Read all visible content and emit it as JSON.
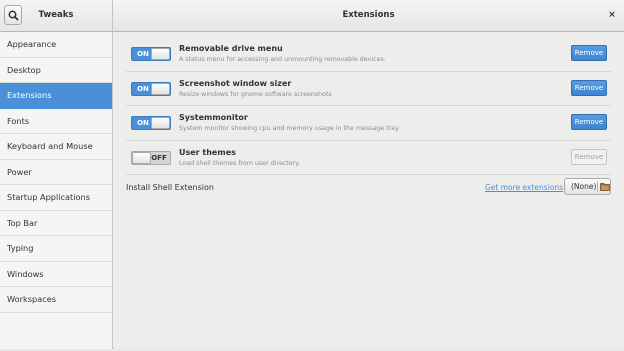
{
  "header": {
    "app_title": "Tweaks",
    "page_title": "Extensions",
    "close_glyph": "×",
    "icons": {
      "search": "search-icon",
      "close": "close-icon"
    }
  },
  "sidebar": {
    "items": [
      {
        "label": "Appearance",
        "active": false
      },
      {
        "label": "Desktop",
        "active": false
      },
      {
        "label": "Extensions",
        "active": true
      },
      {
        "label": "Fonts",
        "active": false
      },
      {
        "label": "Keyboard and Mouse",
        "active": false
      },
      {
        "label": "Power",
        "active": false
      },
      {
        "label": "Startup Applications",
        "active": false
      },
      {
        "label": "Top Bar",
        "active": false
      },
      {
        "label": "Typing",
        "active": false
      },
      {
        "label": "Windows",
        "active": false
      },
      {
        "label": "Workspaces",
        "active": false
      }
    ]
  },
  "extensions": [
    {
      "name": "Removable drive menu",
      "description": "A status menu for accessing and unmounting removable devices.",
      "toggle": "ON",
      "enabled": true,
      "remove_label": "Remove"
    },
    {
      "name": "Screenshot window sizer",
      "description": "Resize windows for gnome software screenshots",
      "toggle": "ON",
      "enabled": true,
      "remove_label": "Remove"
    },
    {
      "name": "Systemmonitor",
      "description": "System monitor showing cpu and memory usage in the message tray.",
      "toggle": "ON",
      "enabled": true,
      "remove_label": "Remove"
    },
    {
      "name": "User themes",
      "description": "Load shell themes from user directory.",
      "toggle": "OFF",
      "enabled": false,
      "remove_label": "Remove"
    }
  ],
  "install": {
    "label": "Install Shell Extension",
    "link": "Get more extensions",
    "file_value": "(None)",
    "folder_icon": "folder-icon"
  },
  "colors": {
    "accent": "#4a90d9"
  }
}
